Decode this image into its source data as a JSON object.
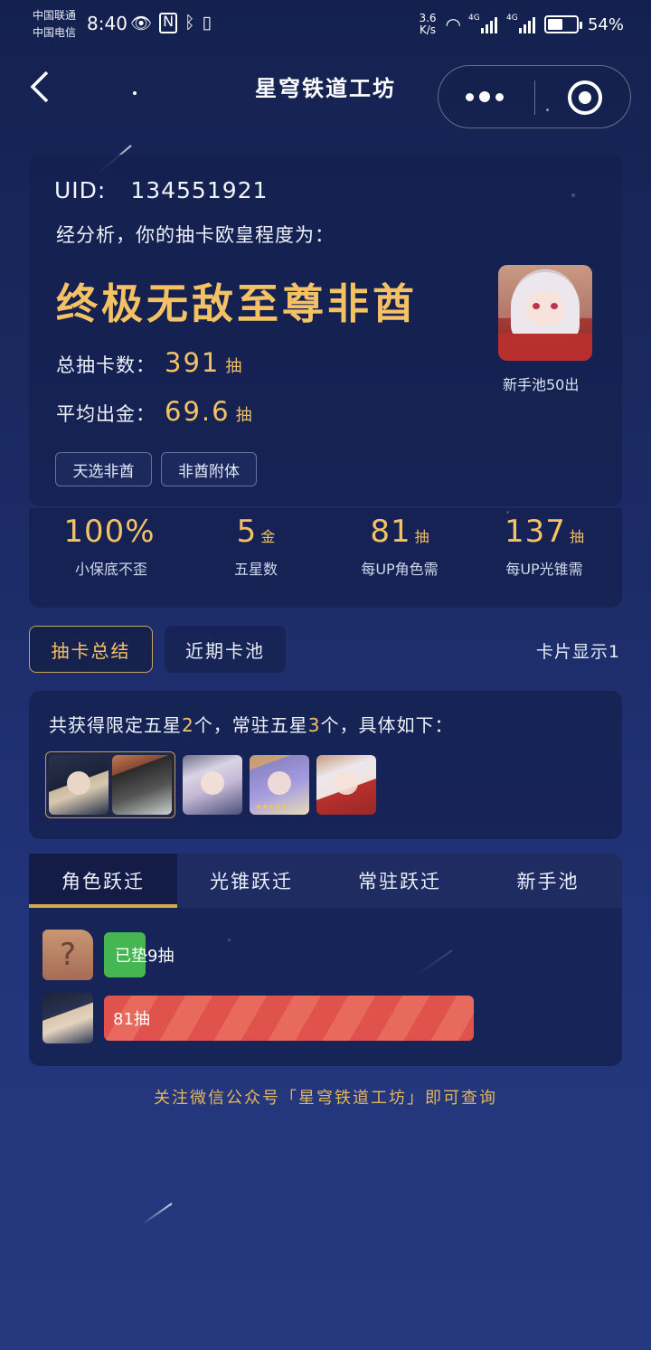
{
  "status_bar": {
    "carrier1": "中国联通",
    "carrier2": "中国电信",
    "time": "8:40",
    "speed_value": "3.6",
    "speed_unit": "K/s",
    "network_tag1": "4G",
    "network_tag2": "4G",
    "battery_percent": "54%",
    "battery_level": 0.54
  },
  "nav": {
    "title": "星穹铁道工坊"
  },
  "summary": {
    "uid_label": "UID:",
    "uid_value": "134551921",
    "analysis_text": "经分析，你的抽卡欧皇程度为：",
    "rank_title": "终极无敌至尊非酋",
    "total_label": "总抽卡数：",
    "total_value": "391",
    "total_unit": "抽",
    "avg_label": "平均出金：",
    "avg_value": "69.6",
    "avg_unit": "抽",
    "avatar_caption": "新手池50出",
    "tags": [
      "天选非酋",
      "非酋附体"
    ]
  },
  "kpis": [
    {
      "value": "100%",
      "unit": "",
      "label": "小保底不歪"
    },
    {
      "value": "5",
      "unit": "金",
      "label": "五星数"
    },
    {
      "value": "81",
      "unit": "抽",
      "label": "每UP角色需"
    },
    {
      "value": "137",
      "unit": "抽",
      "label": "每UP光锥需"
    }
  ],
  "segments": {
    "active": "抽卡总结",
    "inactive": "近期卡池",
    "card_display": "卡片显示1"
  },
  "obtained": {
    "prefix": "共获得限定五星",
    "limited_count": "2",
    "mid": "个，常驻五星",
    "standard_count": "3",
    "suffix": "个，具体如下："
  },
  "warp_tabs": [
    "角色跃迁",
    "光锥跃迁",
    "常驻跃迁",
    "新手池"
  ],
  "pulls": [
    {
      "avatar": "?",
      "label": "已垫9抽",
      "color": "#46b653"
    },
    {
      "avatar": "",
      "label": "81抽",
      "color": "#e0534d"
    }
  ],
  "footer": "关注微信公众号「星穹铁道工坊」即可查询"
}
